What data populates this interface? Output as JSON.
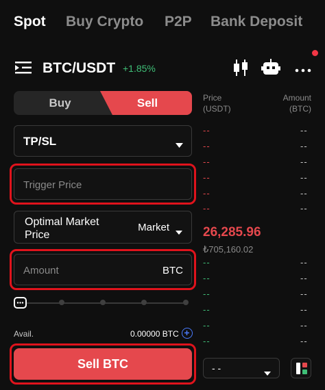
{
  "top_tabs": [
    "Spot",
    "Buy Crypto",
    "P2P",
    "Bank Deposit"
  ],
  "pair": {
    "symbol": "BTC/USDT",
    "change": "+1.85%"
  },
  "trade": {
    "buy_label": "Buy",
    "sell_label": "Sell",
    "order_type": "TP/SL",
    "trigger_placeholder": "Trigger Price",
    "price_mode_label": "Optimal Market Price",
    "price_mode_line1": "Optimal Market",
    "price_mode_line2": "Price",
    "price_mode_value": "Market",
    "amount_placeholder": "Amount",
    "amount_unit": "BTC",
    "slider_value": 0,
    "avail_label": "Avail.",
    "avail_value": "0.00000 BTC",
    "submit_label": "Sell BTC"
  },
  "orderbook": {
    "price_header_1": "Price",
    "price_header_2": "(USDT)",
    "amount_header_1": "Amount",
    "amount_header_2": "(BTC)",
    "placeholder": "--",
    "last_price": "26,285.96",
    "last_price_local": "₺705,160.02",
    "depth_select": "- -"
  },
  "colors": {
    "accent_red": "#e5484d",
    "highlight_red": "#e0131c",
    "up_green": "#3fbf77",
    "background": "#0f0f0f"
  }
}
